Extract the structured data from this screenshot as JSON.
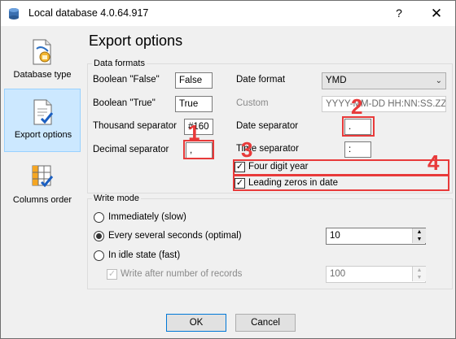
{
  "window": {
    "title": "Local database 4.0.64.917",
    "help": "?",
    "close": "✕"
  },
  "sidebar": {
    "items": [
      {
        "label": "Database type",
        "icon": "database-type-icon"
      },
      {
        "label": "Export options",
        "icon": "export-options-icon"
      },
      {
        "label": "Columns order",
        "icon": "columns-order-icon"
      }
    ]
  },
  "main": {
    "title": "Export options",
    "data_formats": {
      "title": "Data formats",
      "boolean_false_label": "Boolean \"False\"",
      "boolean_false_value": "False",
      "boolean_true_label": "Boolean \"True\"",
      "boolean_true_value": "True",
      "thousand_separator_label": "Thousand separator",
      "thousand_separator_value": "#160",
      "decimal_separator_label": "Decimal separator",
      "decimal_separator_value": ",",
      "date_format_label": "Date format",
      "date_format_value": "YMD",
      "custom_label": "Custom",
      "custom_value": "YYYY-MM-DD HH:NN:SS.ZZZ",
      "date_separator_label": "Date separator",
      "date_separator_value": ".",
      "time_separator_label": "Time separator",
      "time_separator_value": ":",
      "four_digit_year_label": "Four digit year",
      "four_digit_year_checked": true,
      "leading_zeros_label": "Leading zeros in date",
      "leading_zeros_checked": true
    },
    "write_mode": {
      "title": "Write mode",
      "immediately_label": "Immediately (slow)",
      "every_seconds_label": "Every several seconds (optimal)",
      "every_seconds_value": "10",
      "idle_label": "In idle state (fast)",
      "after_records_label": "Write after number of records",
      "after_records_value": "100",
      "selected": "every_seconds"
    }
  },
  "annotations": {
    "n1": "1",
    "n2": "2",
    "n3": "3",
    "n4": "4",
    "color": "#e83a3a"
  },
  "footer": {
    "ok": "OK",
    "cancel": "Cancel"
  }
}
